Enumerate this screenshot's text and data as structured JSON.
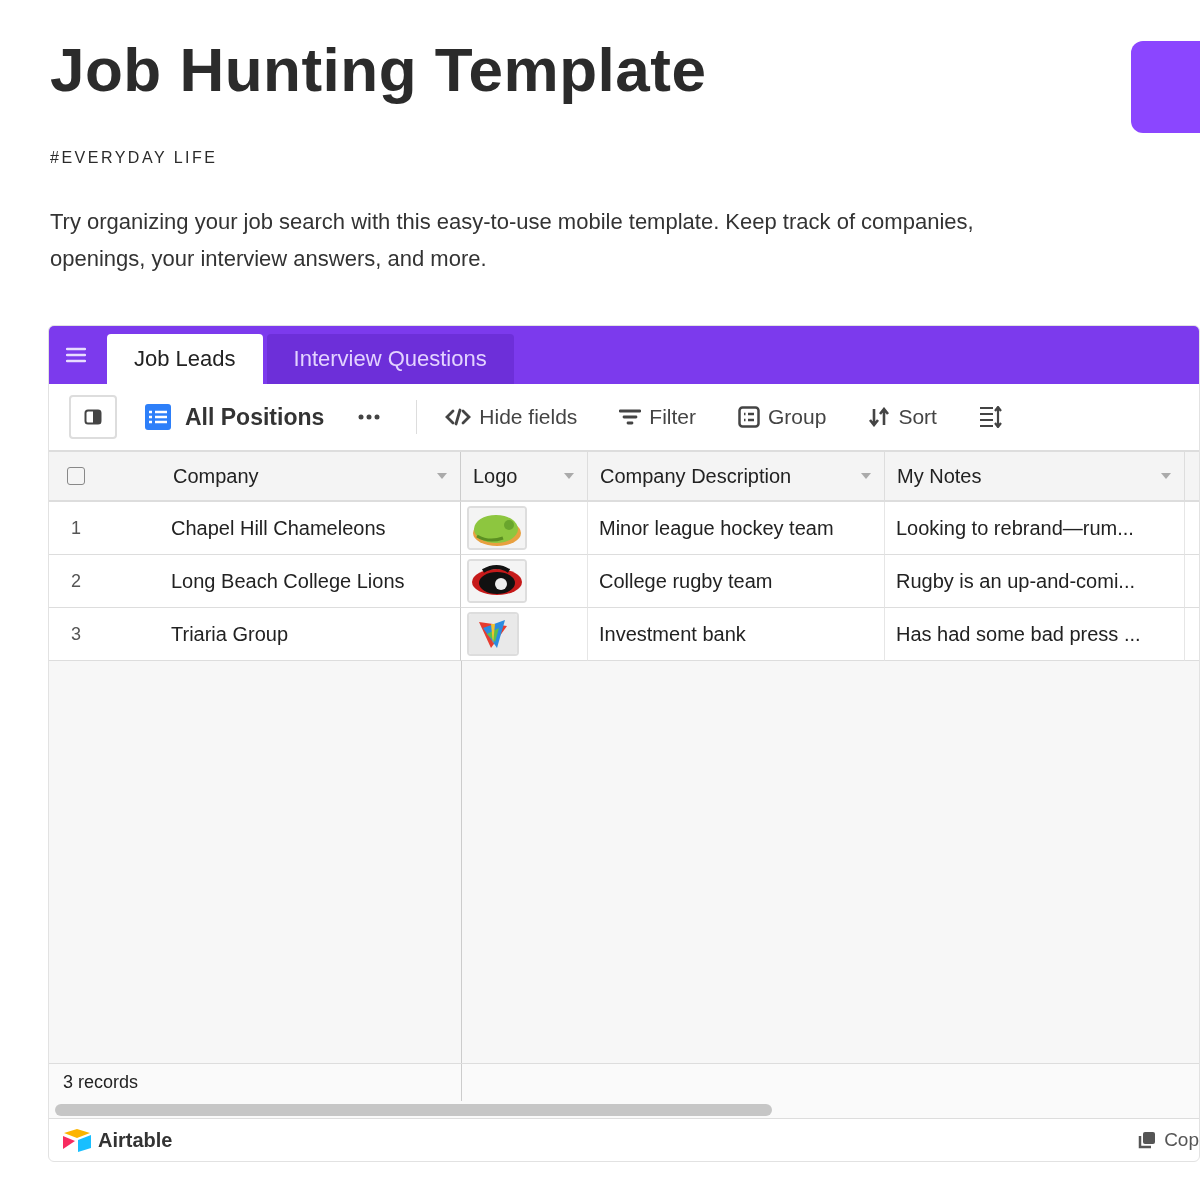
{
  "title": "Job Hunting Template",
  "tag": "#EVERYDAY LIFE",
  "description": "Try organizing your job search with this easy-to-use mobile template. Keep track of companies, openings, your interview answers, and more.",
  "base": {
    "tabs": [
      {
        "label": "Job Leads",
        "selected": true
      },
      {
        "label": "Interview Questions",
        "selected": false
      }
    ],
    "view": {
      "name": "All Positions"
    },
    "toolbar": [
      {
        "kind": "hide",
        "label": "Hide fields"
      },
      {
        "kind": "filter",
        "label": "Filter"
      },
      {
        "kind": "group",
        "label": "Group"
      },
      {
        "kind": "sort",
        "label": "Sort"
      },
      {
        "kind": "row-height"
      }
    ],
    "select_all": {
      "checked": false
    },
    "columns": [
      "Company",
      "Logo",
      "Company Description",
      "My Notes"
    ],
    "rows": [
      {
        "number": "1",
        "company": "Chapel Hill Chameleons",
        "description": "Minor league hockey team",
        "notes": "Looking to rebrand—rum..."
      },
      {
        "number": "2",
        "company": "Long Beach College Lions",
        "description": "College rugby team",
        "notes": "Rugby is an up-and-comi..."
      },
      {
        "number": "3",
        "company": "Triaria Group",
        "description": "Investment bank",
        "notes": "Has had some bad press ..."
      }
    ],
    "record_count": "3 records",
    "brand": "Airtable",
    "copy_link": "Cop"
  }
}
